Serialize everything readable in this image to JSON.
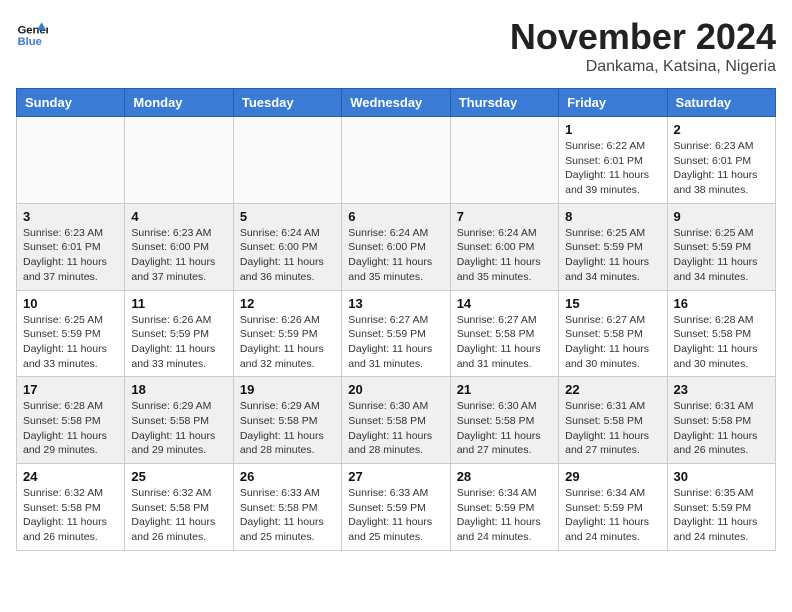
{
  "header": {
    "logo_line1": "General",
    "logo_line2": "Blue",
    "month_year": "November 2024",
    "location": "Dankama, Katsina, Nigeria"
  },
  "days_of_week": [
    "Sunday",
    "Monday",
    "Tuesday",
    "Wednesday",
    "Thursday",
    "Friday",
    "Saturday"
  ],
  "weeks": [
    [
      {
        "day": "",
        "empty": true
      },
      {
        "day": "",
        "empty": true
      },
      {
        "day": "",
        "empty": true
      },
      {
        "day": "",
        "empty": true
      },
      {
        "day": "",
        "empty": true
      },
      {
        "day": "1",
        "sunrise": "Sunrise: 6:22 AM",
        "sunset": "Sunset: 6:01 PM",
        "daylight": "Daylight: 11 hours and 39 minutes."
      },
      {
        "day": "2",
        "sunrise": "Sunrise: 6:23 AM",
        "sunset": "Sunset: 6:01 PM",
        "daylight": "Daylight: 11 hours and 38 minutes."
      }
    ],
    [
      {
        "day": "3",
        "sunrise": "Sunrise: 6:23 AM",
        "sunset": "Sunset: 6:01 PM",
        "daylight": "Daylight: 11 hours and 37 minutes."
      },
      {
        "day": "4",
        "sunrise": "Sunrise: 6:23 AM",
        "sunset": "Sunset: 6:00 PM",
        "daylight": "Daylight: 11 hours and 37 minutes."
      },
      {
        "day": "5",
        "sunrise": "Sunrise: 6:24 AM",
        "sunset": "Sunset: 6:00 PM",
        "daylight": "Daylight: 11 hours and 36 minutes."
      },
      {
        "day": "6",
        "sunrise": "Sunrise: 6:24 AM",
        "sunset": "Sunset: 6:00 PM",
        "daylight": "Daylight: 11 hours and 35 minutes."
      },
      {
        "day": "7",
        "sunrise": "Sunrise: 6:24 AM",
        "sunset": "Sunset: 6:00 PM",
        "daylight": "Daylight: 11 hours and 35 minutes."
      },
      {
        "day": "8",
        "sunrise": "Sunrise: 6:25 AM",
        "sunset": "Sunset: 5:59 PM",
        "daylight": "Daylight: 11 hours and 34 minutes."
      },
      {
        "day": "9",
        "sunrise": "Sunrise: 6:25 AM",
        "sunset": "Sunset: 5:59 PM",
        "daylight": "Daylight: 11 hours and 34 minutes."
      }
    ],
    [
      {
        "day": "10",
        "sunrise": "Sunrise: 6:25 AM",
        "sunset": "Sunset: 5:59 PM",
        "daylight": "Daylight: 11 hours and 33 minutes."
      },
      {
        "day": "11",
        "sunrise": "Sunrise: 6:26 AM",
        "sunset": "Sunset: 5:59 PM",
        "daylight": "Daylight: 11 hours and 33 minutes."
      },
      {
        "day": "12",
        "sunrise": "Sunrise: 6:26 AM",
        "sunset": "Sunset: 5:59 PM",
        "daylight": "Daylight: 11 hours and 32 minutes."
      },
      {
        "day": "13",
        "sunrise": "Sunrise: 6:27 AM",
        "sunset": "Sunset: 5:59 PM",
        "daylight": "Daylight: 11 hours and 31 minutes."
      },
      {
        "day": "14",
        "sunrise": "Sunrise: 6:27 AM",
        "sunset": "Sunset: 5:58 PM",
        "daylight": "Daylight: 11 hours and 31 minutes."
      },
      {
        "day": "15",
        "sunrise": "Sunrise: 6:27 AM",
        "sunset": "Sunset: 5:58 PM",
        "daylight": "Daylight: 11 hours and 30 minutes."
      },
      {
        "day": "16",
        "sunrise": "Sunrise: 6:28 AM",
        "sunset": "Sunset: 5:58 PM",
        "daylight": "Daylight: 11 hours and 30 minutes."
      }
    ],
    [
      {
        "day": "17",
        "sunrise": "Sunrise: 6:28 AM",
        "sunset": "Sunset: 5:58 PM",
        "daylight": "Daylight: 11 hours and 29 minutes."
      },
      {
        "day": "18",
        "sunrise": "Sunrise: 6:29 AM",
        "sunset": "Sunset: 5:58 PM",
        "daylight": "Daylight: 11 hours and 29 minutes."
      },
      {
        "day": "19",
        "sunrise": "Sunrise: 6:29 AM",
        "sunset": "Sunset: 5:58 PM",
        "daylight": "Daylight: 11 hours and 28 minutes."
      },
      {
        "day": "20",
        "sunrise": "Sunrise: 6:30 AM",
        "sunset": "Sunset: 5:58 PM",
        "daylight": "Daylight: 11 hours and 28 minutes."
      },
      {
        "day": "21",
        "sunrise": "Sunrise: 6:30 AM",
        "sunset": "Sunset: 5:58 PM",
        "daylight": "Daylight: 11 hours and 27 minutes."
      },
      {
        "day": "22",
        "sunrise": "Sunrise: 6:31 AM",
        "sunset": "Sunset: 5:58 PM",
        "daylight": "Daylight: 11 hours and 27 minutes."
      },
      {
        "day": "23",
        "sunrise": "Sunrise: 6:31 AM",
        "sunset": "Sunset: 5:58 PM",
        "daylight": "Daylight: 11 hours and 26 minutes."
      }
    ],
    [
      {
        "day": "24",
        "sunrise": "Sunrise: 6:32 AM",
        "sunset": "Sunset: 5:58 PM",
        "daylight": "Daylight: 11 hours and 26 minutes."
      },
      {
        "day": "25",
        "sunrise": "Sunrise: 6:32 AM",
        "sunset": "Sunset: 5:58 PM",
        "daylight": "Daylight: 11 hours and 26 minutes."
      },
      {
        "day": "26",
        "sunrise": "Sunrise: 6:33 AM",
        "sunset": "Sunset: 5:58 PM",
        "daylight": "Daylight: 11 hours and 25 minutes."
      },
      {
        "day": "27",
        "sunrise": "Sunrise: 6:33 AM",
        "sunset": "Sunset: 5:59 PM",
        "daylight": "Daylight: 11 hours and 25 minutes."
      },
      {
        "day": "28",
        "sunrise": "Sunrise: 6:34 AM",
        "sunset": "Sunset: 5:59 PM",
        "daylight": "Daylight: 11 hours and 24 minutes."
      },
      {
        "day": "29",
        "sunrise": "Sunrise: 6:34 AM",
        "sunset": "Sunset: 5:59 PM",
        "daylight": "Daylight: 11 hours and 24 minutes."
      },
      {
        "day": "30",
        "sunrise": "Sunrise: 6:35 AM",
        "sunset": "Sunset: 5:59 PM",
        "daylight": "Daylight: 11 hours and 24 minutes."
      }
    ]
  ]
}
